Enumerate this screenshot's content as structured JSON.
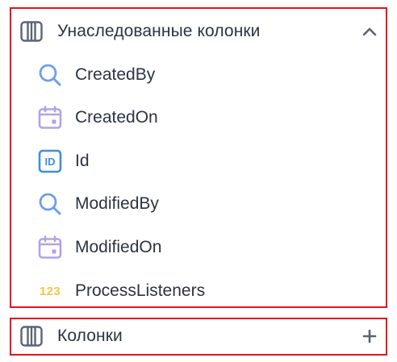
{
  "colors": {
    "frame": "#e3141f",
    "text": "#2b3442",
    "search_icon": "#6f9fe8",
    "date_icon": "#b3a3e6",
    "id_icon": "#3f8fe0",
    "number_icon": "#f7c542",
    "muted_icon": "#5b6473"
  },
  "inherited_group": {
    "label": "Унаследованные колонки",
    "icon": "columns-icon",
    "action_icon": "chevron-up-icon",
    "items": [
      {
        "label": "CreatedBy",
        "icon": "search-icon"
      },
      {
        "label": "CreatedOn",
        "icon": "calendar-icon"
      },
      {
        "label": "Id",
        "icon": "id-icon",
        "icon_text": "ID"
      },
      {
        "label": "ModifiedBy",
        "icon": "search-icon"
      },
      {
        "label": "ModifiedOn",
        "icon": "calendar-icon"
      },
      {
        "label": "ProcessListeners",
        "icon": "number-icon",
        "icon_text": "123"
      }
    ]
  },
  "columns_group": {
    "label": "Колонки",
    "icon": "columns-icon",
    "action_icon": "plus-icon"
  }
}
